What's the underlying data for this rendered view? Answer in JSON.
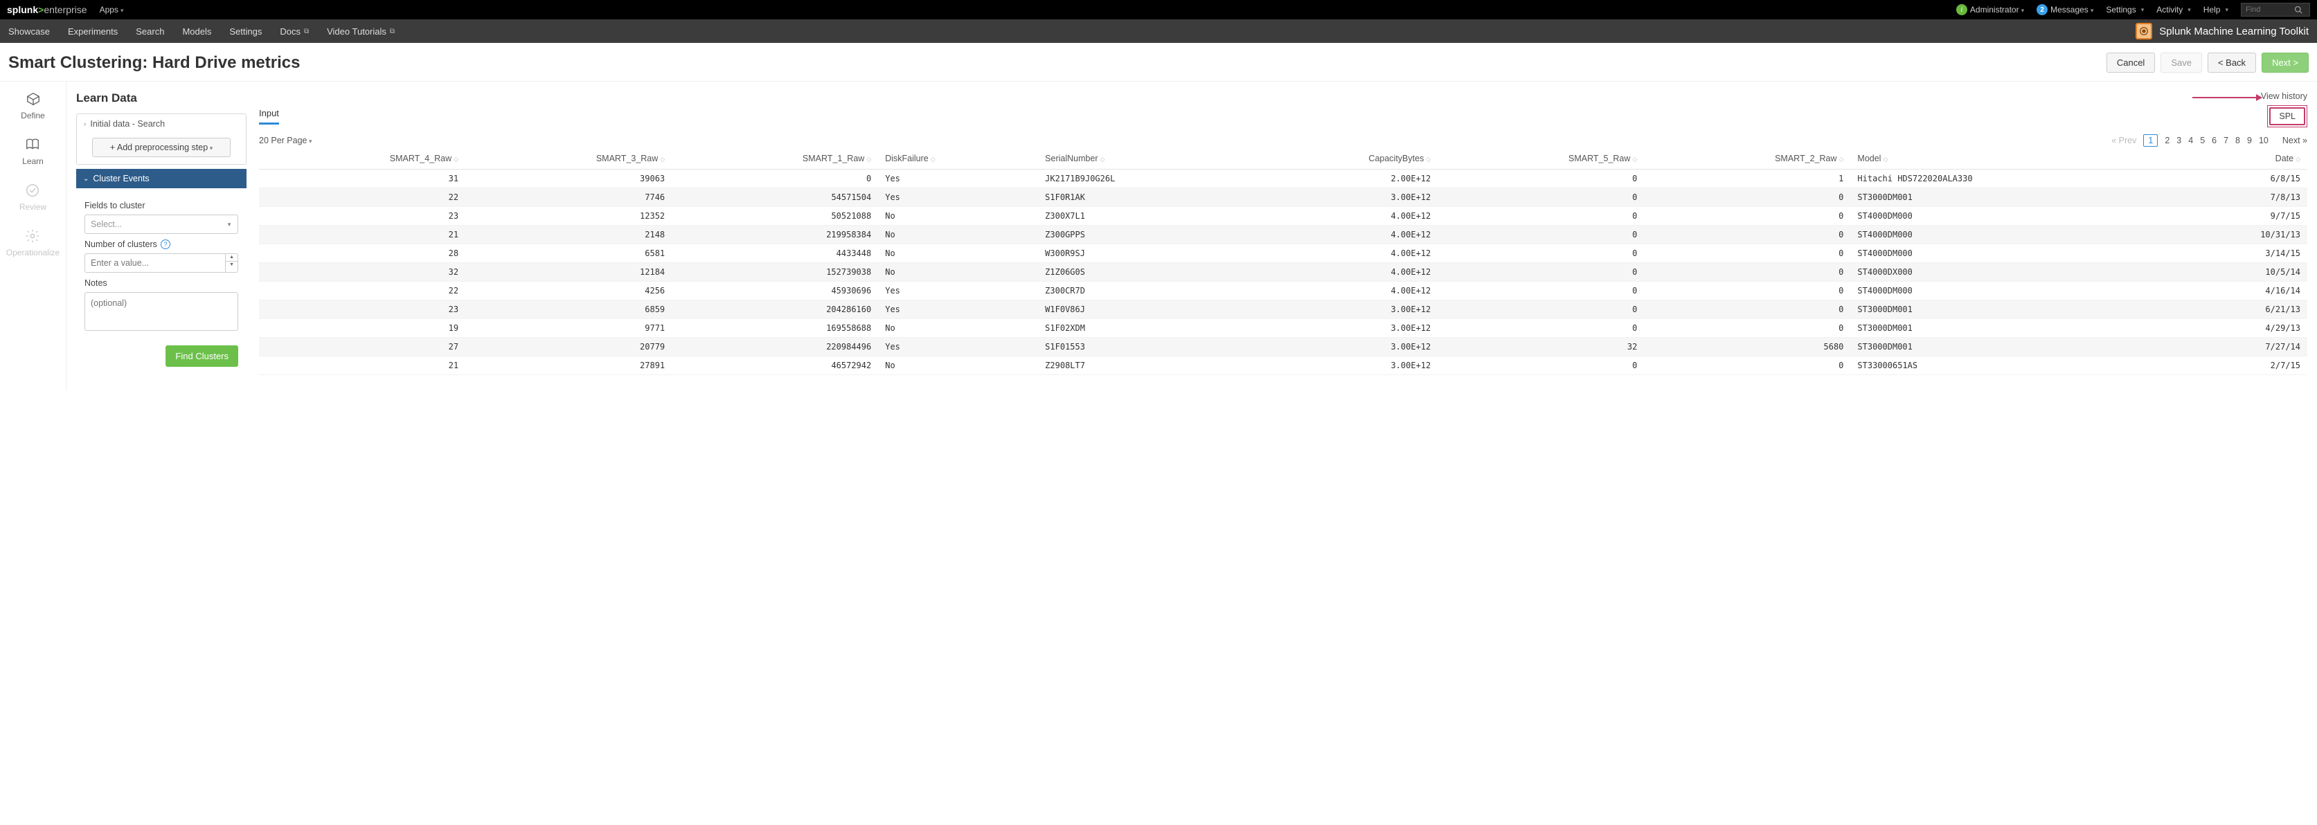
{
  "brand": {
    "splunk": "splunk",
    "gt": ">",
    "enterprise": "enterprise"
  },
  "top_menus": {
    "apps": "Apps",
    "admin": "Administrator",
    "messages": "Messages",
    "messages_badge": "2",
    "settings": "Settings",
    "activity": "Activity",
    "help": "Help",
    "find_placeholder": "Find"
  },
  "subnav": {
    "items": [
      "Showcase",
      "Experiments",
      "Search",
      "Models",
      "Settings",
      "Docs",
      "Video Tutorials"
    ],
    "ext_flags": [
      false,
      false,
      false,
      false,
      false,
      true,
      true
    ],
    "app_name": "Splunk Machine Learning Toolkit"
  },
  "page": {
    "title": "Smart Clustering: Hard Drive metrics",
    "btn_cancel": "Cancel",
    "btn_save": "Save",
    "btn_back": "< Back",
    "btn_next": "Next >"
  },
  "stages": {
    "define": "Define",
    "learn": "Learn",
    "review": "Review",
    "operationalize": "Operationalize"
  },
  "panel": {
    "learn_data": "Learn Data",
    "initial_data": "Initial data - Search",
    "add_step": "Add preprocessing step",
    "cluster_events": "Cluster Events",
    "fields_label": "Fields to cluster",
    "fields_placeholder": "Select...",
    "num_clusters_label": "Number of clusters",
    "num_clusters_placeholder": "Enter a value...",
    "notes_label": "Notes",
    "notes_placeholder": "(optional)",
    "find_clusters": "Find Clusters"
  },
  "data_view": {
    "view_history": "View history",
    "tab_input": "Input",
    "spl": "SPL",
    "per_page": "20 Per Page",
    "prev": "« Prev",
    "next": "Next »",
    "pages": [
      "1",
      "2",
      "3",
      "4",
      "5",
      "6",
      "7",
      "8",
      "9",
      "10"
    ]
  },
  "table": {
    "columns": [
      "SMART_4_Raw",
      "SMART_3_Raw",
      "SMART_1_Raw",
      "DiskFailure",
      "SerialNumber",
      "CapacityBytes",
      "SMART_5_Raw",
      "SMART_2_Raw",
      "Model",
      "Date"
    ],
    "align": [
      "r",
      "r",
      "r",
      "l",
      "l",
      "r",
      "r",
      "r",
      "l",
      "r"
    ],
    "rows": [
      [
        "31",
        "39063",
        "0",
        "Yes",
        "JK2171B9J0G26L",
        "2.00E+12",
        "0",
        "1",
        "Hitachi HDS722020ALA330",
        "6/8/15"
      ],
      [
        "22",
        "7746",
        "54571504",
        "Yes",
        "S1F0R1AK",
        "3.00E+12",
        "0",
        "0",
        "ST3000DM001",
        "7/8/13"
      ],
      [
        "23",
        "12352",
        "50521088",
        "No",
        "Z300X7L1",
        "4.00E+12",
        "0",
        "0",
        "ST4000DM000",
        "9/7/15"
      ],
      [
        "21",
        "2148",
        "219958384",
        "No",
        "Z300GPPS",
        "4.00E+12",
        "0",
        "0",
        "ST4000DM000",
        "10/31/13"
      ],
      [
        "28",
        "6581",
        "4433448",
        "No",
        "W300R9SJ",
        "4.00E+12",
        "0",
        "0",
        "ST4000DM000",
        "3/14/15"
      ],
      [
        "32",
        "12184",
        "152739038",
        "No",
        "Z1Z06G0S",
        "4.00E+12",
        "0",
        "0",
        "ST4000DX000",
        "10/5/14"
      ],
      [
        "22",
        "4256",
        "45930696",
        "Yes",
        "Z300CR7D",
        "4.00E+12",
        "0",
        "0",
        "ST4000DM000",
        "4/16/14"
      ],
      [
        "23",
        "6859",
        "204286160",
        "Yes",
        "W1F0V86J",
        "3.00E+12",
        "0",
        "0",
        "ST3000DM001",
        "6/21/13"
      ],
      [
        "19",
        "9771",
        "169558688",
        "No",
        "S1F02XDM",
        "3.00E+12",
        "0",
        "0",
        "ST3000DM001",
        "4/29/13"
      ],
      [
        "27",
        "20779",
        "220984496",
        "Yes",
        "S1F01553",
        "3.00E+12",
        "32",
        "5680",
        "ST3000DM001",
        "7/27/14"
      ],
      [
        "21",
        "27891",
        "46572942",
        "No",
        "Z2908LT7",
        "3.00E+12",
        "0",
        "0",
        "ST33000651AS",
        "2/7/15"
      ]
    ]
  }
}
